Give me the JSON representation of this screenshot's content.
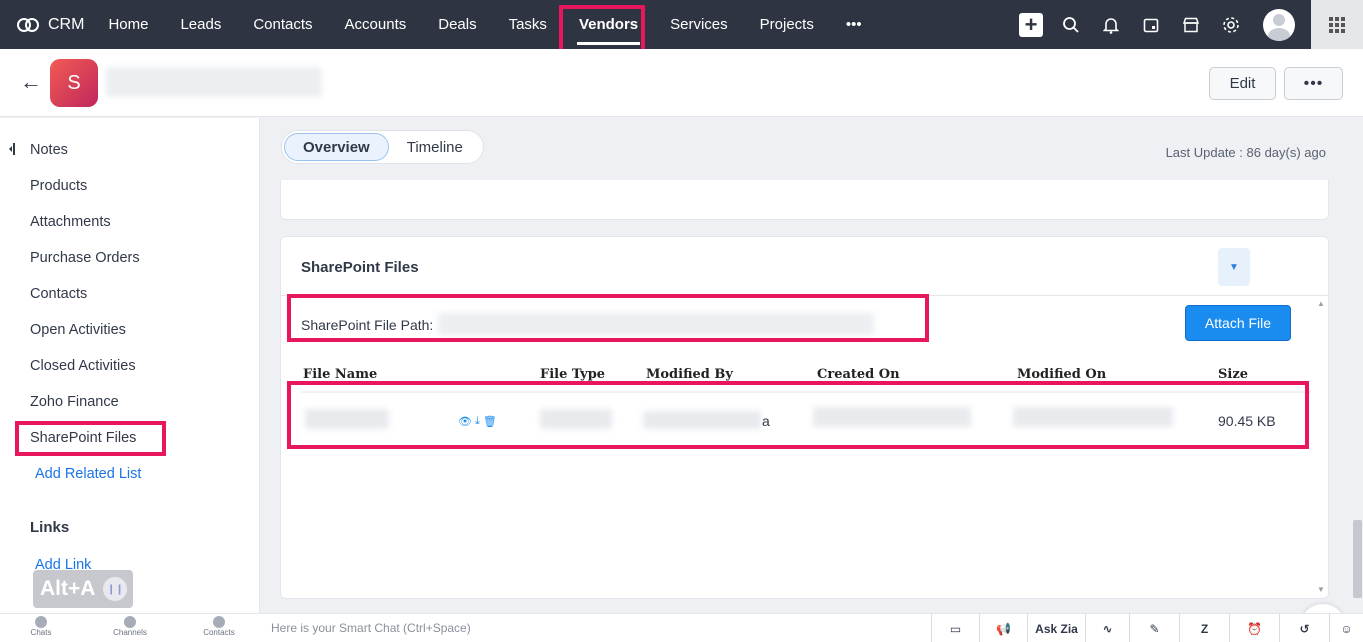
{
  "topbar": {
    "brand": "CRM",
    "nav": [
      "Home",
      "Leads",
      "Contacts",
      "Accounts",
      "Deals",
      "Tasks",
      "Vendors",
      "Services",
      "Projects"
    ],
    "active": "Vendors",
    "more": "•••"
  },
  "record": {
    "avatar_letter": "S",
    "edit_label": "Edit",
    "more_label": "•••"
  },
  "sidebar": {
    "items": [
      "Notes",
      "Products",
      "Attachments",
      "Purchase Orders",
      "Contacts",
      "Open Activities",
      "Closed Activities",
      "Zoho Finance",
      "SharePoint Files"
    ],
    "add_related": "Add Related List",
    "links_heading": "Links",
    "add_link": "Add Link",
    "shortcut": "Alt+A"
  },
  "main": {
    "tabs": [
      "Overview",
      "Timeline"
    ],
    "active_tab": "Overview",
    "last_update": "Last Update : 86 day(s) ago"
  },
  "sharepoint": {
    "title": "SharePoint Files",
    "path_label": "SharePoint File Path:",
    "attach_label": "Attach File",
    "columns": [
      "File Name",
      "File Type",
      "Modified By",
      "Created On",
      "Modified On",
      "Size"
    ],
    "row": {
      "modified_by_tail": "a",
      "size": "90.45 KB"
    }
  },
  "bottombar": {
    "items": [
      "Chats",
      "Channels",
      "Contacts"
    ],
    "smart_chat": "Here is your Smart Chat (Ctrl+Space)",
    "ask_zia": "Ask Zia"
  },
  "colors": {
    "nav_bg": "#2e3441",
    "highlight": "#e8175d",
    "primary": "#1a8cf0"
  }
}
